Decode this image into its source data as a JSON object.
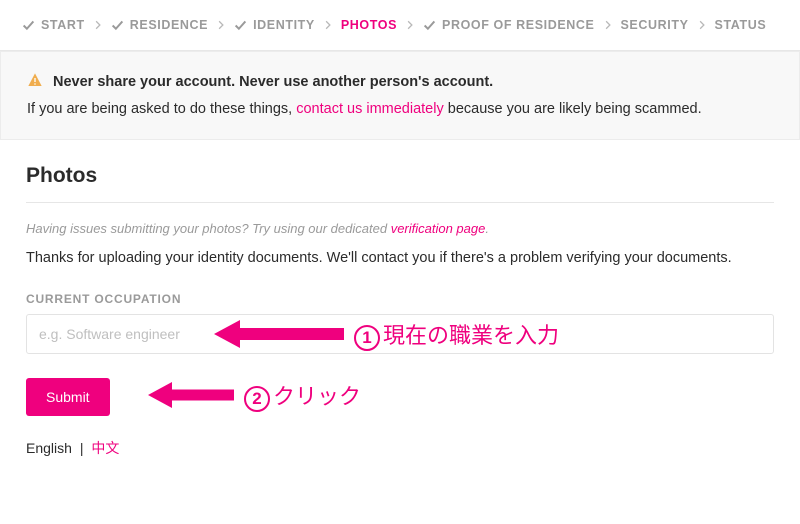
{
  "steps": [
    {
      "label": "START",
      "checked": true,
      "active": false
    },
    {
      "label": "RESIDENCE",
      "checked": true,
      "active": false
    },
    {
      "label": "IDENTITY",
      "checked": true,
      "active": false
    },
    {
      "label": "PHOTOS",
      "checked": false,
      "active": true
    },
    {
      "label": "PROOF OF RESIDENCE",
      "checked": true,
      "active": false
    },
    {
      "label": "SECURITY",
      "checked": false,
      "active": false
    },
    {
      "label": "STATUS",
      "checked": false,
      "active": false
    }
  ],
  "alert": {
    "line1": "Never share your account. Never use another person's account.",
    "line2_pre": "If you are being asked to do these things, ",
    "line2_link": "contact us immediately",
    "line2_post": " because you are likely being scammed."
  },
  "main": {
    "heading": "Photos",
    "help_pre": "Having issues submitting your photos? Try using our dedicated ",
    "help_link": "verification page",
    "help_post": ".",
    "thanks": "Thanks for uploading your identity documents. We'll contact you if there's a problem verifying your documents.",
    "occupation_label": "CURRENT OCCUPATION",
    "occupation_placeholder": "e.g. Software engineer",
    "submit_label": "Submit"
  },
  "lang": {
    "en": "English",
    "sep": "|",
    "zh": "中文"
  },
  "annotations": {
    "a1_num": "1",
    "a1_text": "現在の職業を入力",
    "a2_num": "2",
    "a2_text": "クリック"
  },
  "colors": {
    "accent": "#ef007e",
    "muted": "#9a9a9a",
    "border": "#e6e6e6",
    "alert_bg": "#f8f8f8"
  }
}
